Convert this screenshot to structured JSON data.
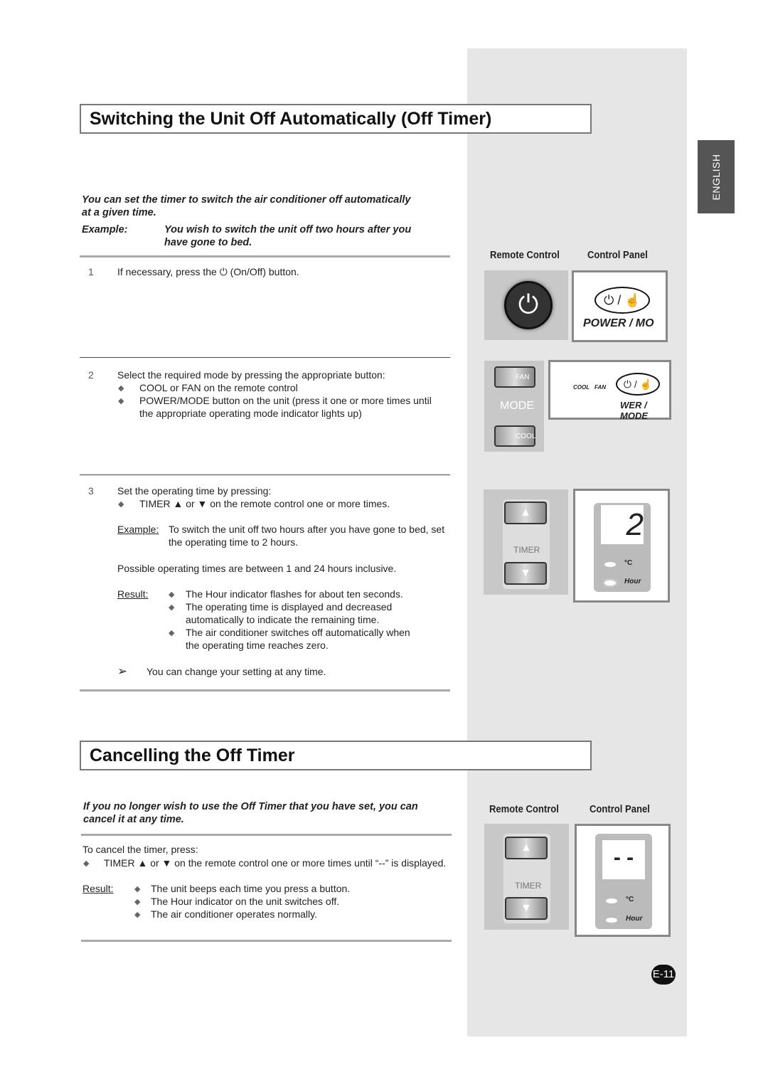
{
  "sidebar_tab": "ENGLISH",
  "section1": {
    "title": "Switching the Unit Off Automatically (Off Timer)",
    "intro": [
      "You can set the timer to switch the air conditioner off automatically",
      "at a given time."
    ],
    "example_label": "Example:",
    "example_text": [
      "You wish to switch the unit off two hours after you",
      "have gone to bed."
    ],
    "steps": [
      {
        "num": "1",
        "lines": [
          "If necessary, press the",
          "(On/Off) button."
        ]
      },
      {
        "num": "2",
        "lines": [
          "Select the required mode by pressing the appropriate button:",
          "COOL or FAN on the remote control",
          "POWER/MODE button on the unit (press it one or more times until",
          "the appropriate operating mode indicator lights up)"
        ]
      },
      {
        "num": "3",
        "lines": [
          "Set the operating time by pressing:",
          "TIMER ▲ or ▼ on the remote control one or more times."
        ],
        "example_label": "Example:",
        "example": [
          "To switch the unit off two hours after you have gone to bed, set",
          "the operating time to 2 hours."
        ],
        "possible": "Possible operating times are between 1 and 24 hours inclusive.",
        "result_label": "Result:",
        "results": [
          "The Hour indicator flashes for about ten seconds.",
          "The operating time is displayed and decreased",
          "automatically to indicate the remaining time.",
          "The air conditioner switches off automatically when",
          "the operating time reaches zero."
        ],
        "note": "You can change your setting at any time."
      }
    ]
  },
  "section2": {
    "title": "Cancelling the Off Timer",
    "intro": [
      "If you no longer wish to use the Off Timer that you have set, you can",
      "cancel it at any time."
    ],
    "cancel_text": "To cancel the timer, press:",
    "cancel_item": "TIMER ▲ or ▼ on the remote control one or more times until “--” is displayed.",
    "result_label": "Result:",
    "results": [
      "The unit beeps each time you press a button.",
      "The Hour indicator on the unit switches off.",
      "The air conditioner operates normally."
    ]
  },
  "figures": {
    "remote_label": "Remote Control",
    "panel_label": "Control Panel",
    "power_mode": "POWER / MO",
    "power_mode2": "WER / MODE",
    "fan": "FAN",
    "cool": "COOL",
    "mode": "MODE",
    "timer": "TIMER",
    "display_value": "2",
    "display_cancel": "- -",
    "celsius": "°C",
    "hour": "Hour"
  },
  "page_number": "E-11",
  "colors": {
    "sidebar_bg": "#e6e6e6",
    "tab_bg": "#555555"
  }
}
